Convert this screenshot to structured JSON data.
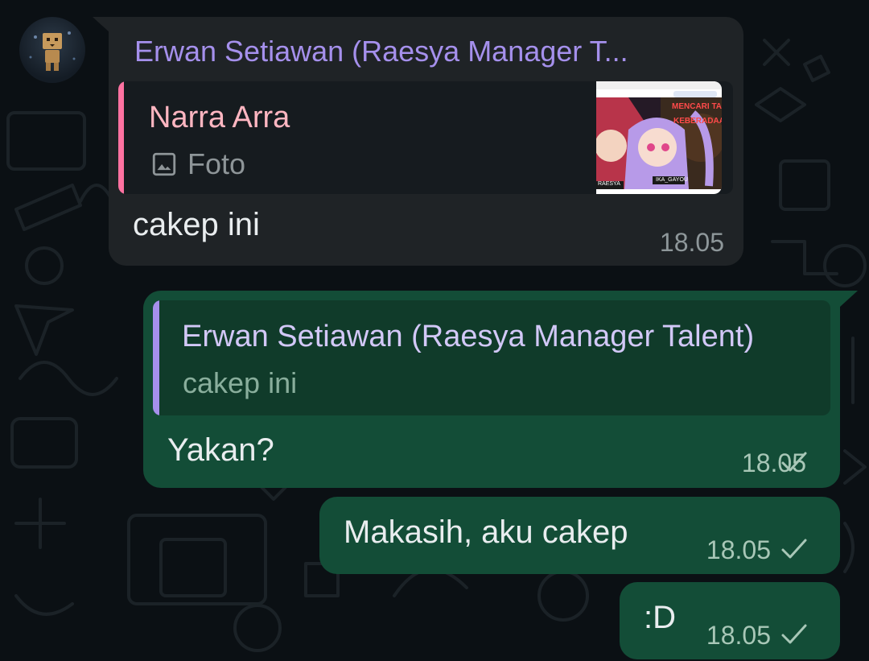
{
  "messages": [
    {
      "sender": "Erwan Setiawan (Raesya Manager T...",
      "reply": {
        "name": "Narra Arra",
        "type": "Foto",
        "thumbnail_text": [
          "MENCARI TA",
          "KEBERADAA",
          "RAESYA",
          "IKA_GAYOU"
        ]
      },
      "text": "cakep ini",
      "time": "18.05"
    },
    {
      "reply": {
        "name": "Erwan Setiawan (Raesya Manager Talent)",
        "text": "cakep ini"
      },
      "text": "Yakan?",
      "time": "18.05"
    },
    {
      "text": "Makasih, aku cakep",
      "time": "18.05"
    },
    {
      "text": ":D",
      "time": "18.05"
    }
  ],
  "colors": {
    "background": "#0b1014",
    "incoming_bubble": "#1f2326",
    "outgoing_bubble": "#134d37",
    "sender_name": "#a590ec",
    "reply_accent_pink": "#ff72a1",
    "reply_accent_purple": "#a590ec"
  },
  "icons": {
    "avatar": "danbo-figure",
    "photo": "image-icon",
    "status": "check-icon"
  }
}
